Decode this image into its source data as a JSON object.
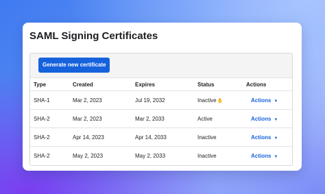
{
  "title": "SAML Signing Certificates",
  "toolbar": {
    "generate_label": "Generate new certificate"
  },
  "table": {
    "headers": [
      "Type",
      "Created",
      "Expires",
      "Status",
      "Actions"
    ],
    "rows": [
      {
        "type": "SHA-1",
        "created": "Mar 2, 2023",
        "expires": "Jul 19, 2032",
        "status": "Inactive",
        "status_icon": "hand-emoji-icon",
        "action": "Actions"
      },
      {
        "type": "SHA-2",
        "created": "Mar 2, 2023",
        "expires": "Mar 2, 2033",
        "status": "Active",
        "action": "Actions"
      },
      {
        "type": "SHA-2",
        "created": "Apr 14, 2023",
        "expires": "Apr 14, 2033",
        "status": "Inactive",
        "action": "Actions"
      },
      {
        "type": "SHA-2",
        "created": "May 2, 2023",
        "expires": "May 2, 2033",
        "status": "Inactive",
        "action": "Actions"
      }
    ]
  },
  "colors": {
    "accent": "#1662dd",
    "text": "#1d1d21",
    "toolbar_bg": "#f4f4f5"
  }
}
